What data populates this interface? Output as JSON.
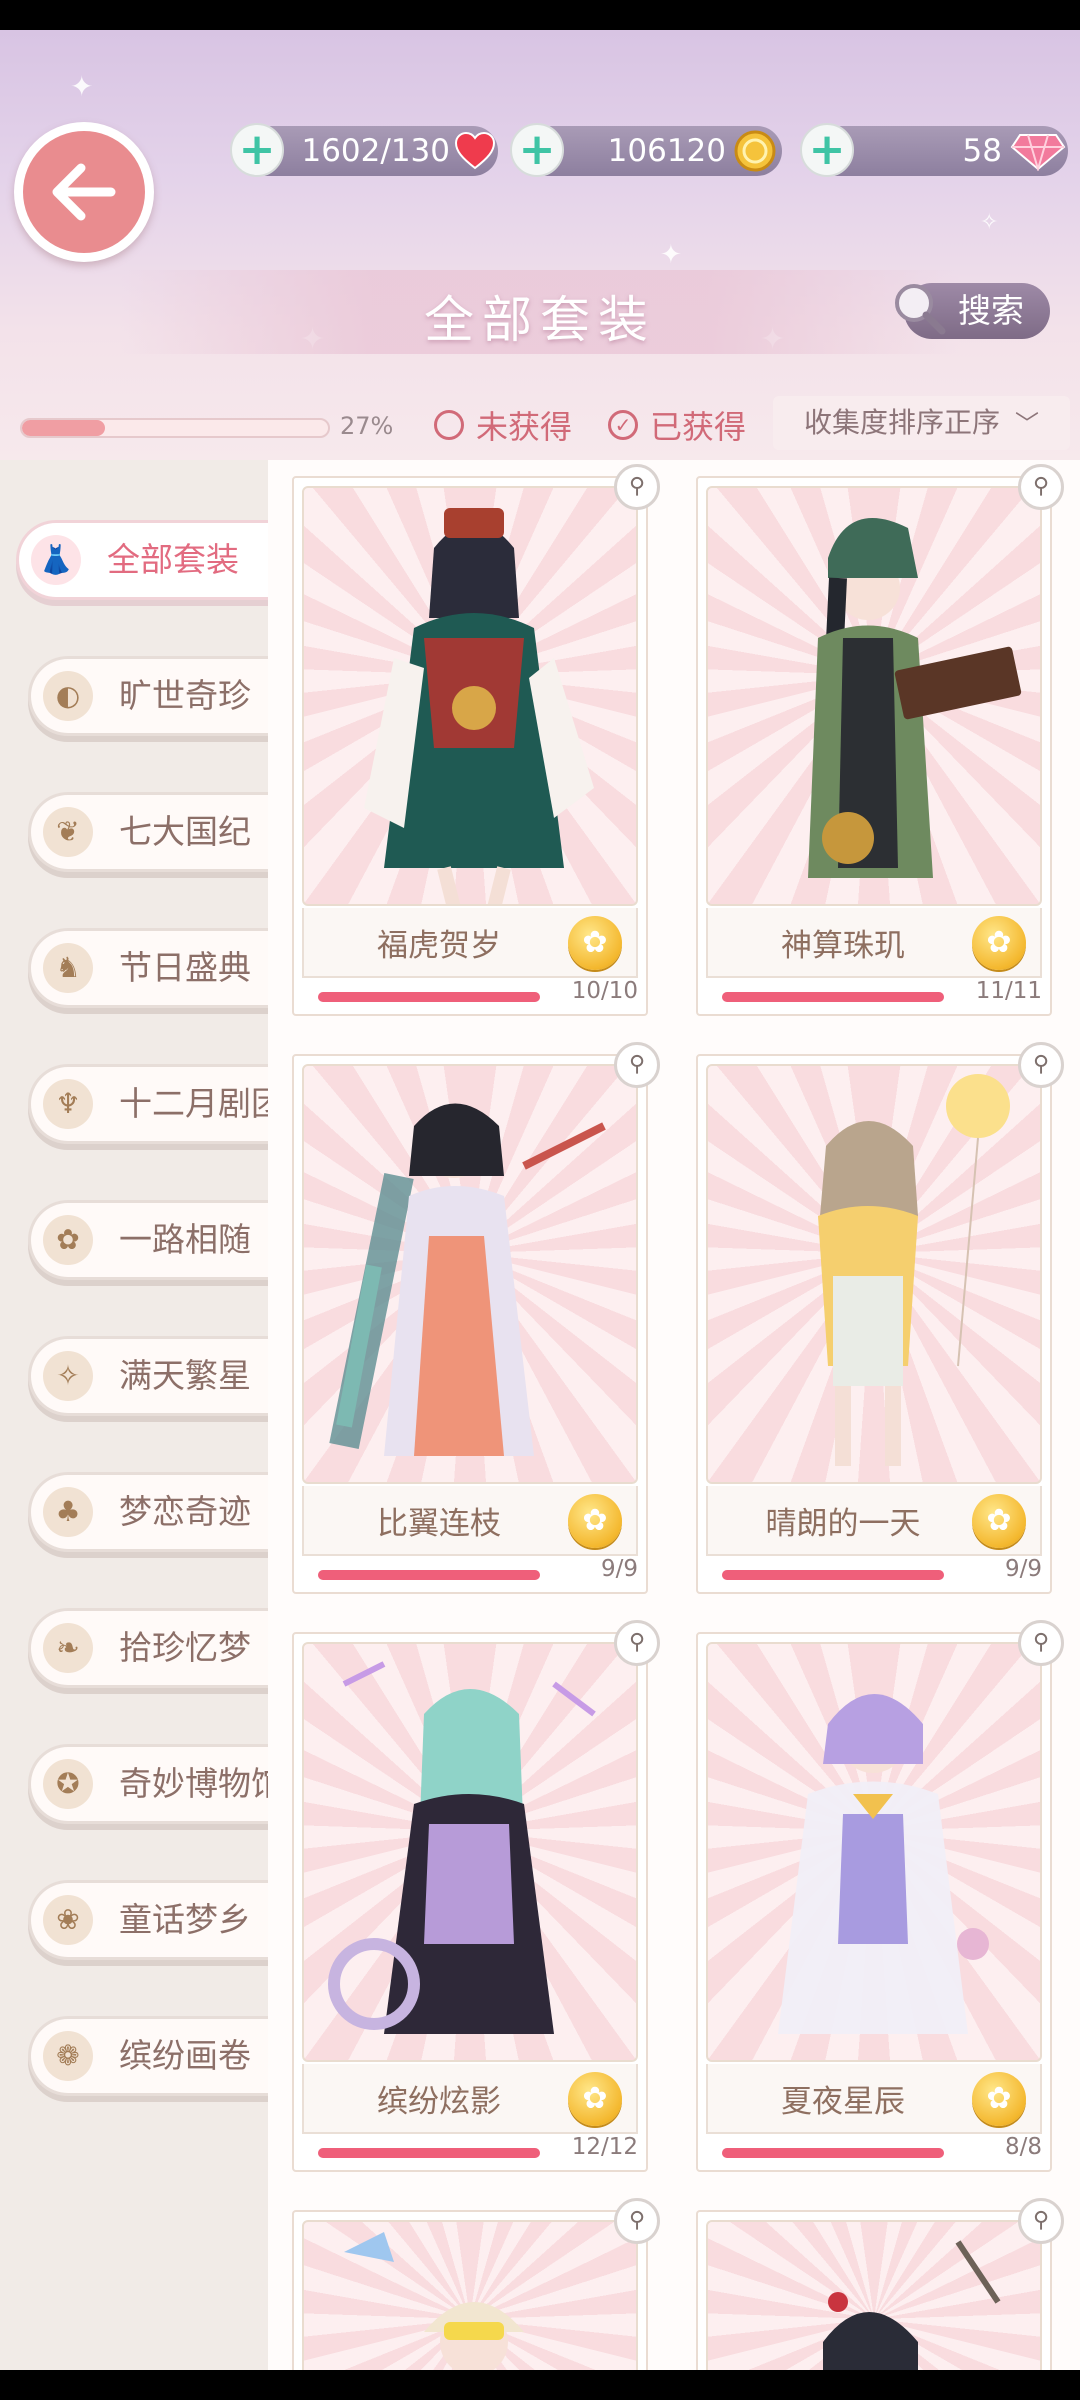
{
  "resources": {
    "stamina": "1602/130",
    "gold": "106120",
    "diamonds": "58"
  },
  "header": {
    "title": "全部套装",
    "search_label": "搜索"
  },
  "collection": {
    "progress": 0.27,
    "progress_text": "27%"
  },
  "filters": {
    "not_obtained": "未获得",
    "obtained": "已获得",
    "sort": "收集度排序正序"
  },
  "sidebar": {
    "items": [
      {
        "label": "全部套装",
        "icon": "dress-icon"
      },
      {
        "label": "旷世奇珍",
        "icon": "shell-icon"
      },
      {
        "label": "七大国纪",
        "icon": "map-icon"
      },
      {
        "label": "节日盛典",
        "icon": "horse-icon"
      },
      {
        "label": "十二月剧团",
        "icon": "chandelier-icon"
      },
      {
        "label": "一路相随",
        "icon": "flower-icon"
      },
      {
        "label": "满天繁星",
        "icon": "constellation-icon"
      },
      {
        "label": "梦恋奇迹",
        "icon": "clover-icon"
      },
      {
        "label": "拾珍忆梦",
        "icon": "branch-icon"
      },
      {
        "label": "奇妙博物馆",
        "icon": "compass-icon"
      },
      {
        "label": "童话梦乡",
        "icon": "book-icon"
      },
      {
        "label": "缤纷画卷",
        "icon": "scroll-icon"
      }
    ]
  },
  "suits": [
    {
      "name": "福虎贺岁",
      "count": "10/10",
      "progress": 1.0
    },
    {
      "name": "神算珠玑",
      "count": "11/11",
      "progress": 1.0
    },
    {
      "name": "比翼连枝",
      "count": "9/9",
      "progress": 1.0
    },
    {
      "name": "晴朗的一天",
      "count": "9/9",
      "progress": 1.0
    },
    {
      "name": "缤纷炫影",
      "count": "12/12",
      "progress": 1.0
    },
    {
      "name": "夏夜星辰",
      "count": "8/8",
      "progress": 1.0
    }
  ],
  "colors": {
    "accent": "#e26b80",
    "progress_fill": "#ef5f7a",
    "badge_gold": "#f4b82f"
  }
}
